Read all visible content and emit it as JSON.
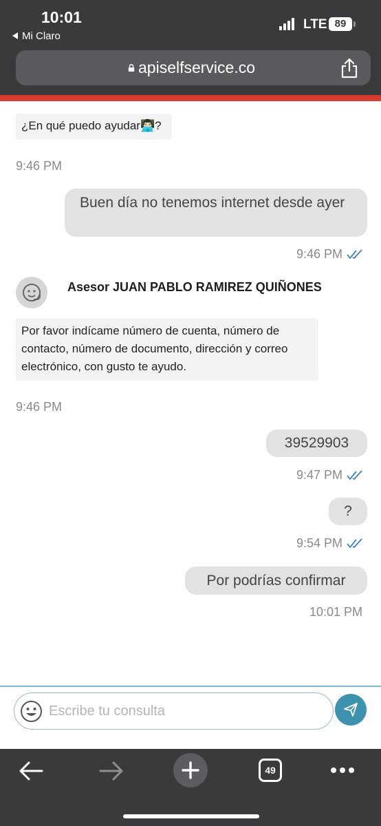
{
  "status_bar": {
    "time": "10:01",
    "back_app": "Mi Claro",
    "network": "LTE",
    "battery": "89"
  },
  "browser": {
    "url": "apiselfservice.co",
    "tab_count": "49"
  },
  "colors": {
    "accent": "#d83b2b",
    "send_button": "#3d93ad",
    "chrome": "#3a3a3c",
    "read_ticks": "#3f7fbf"
  },
  "chat": {
    "agent_name": "Asesor JUAN PABLO RAMIREZ QUIÑONES",
    "messages": [
      {
        "from": "agent",
        "text": "¿En qué puedo ayudar👨🏻‍💻?",
        "time": "9:46 PM"
      },
      {
        "from": "user",
        "text": "Buen día no tenemos internet desde ayer",
        "time": "9:46 PM"
      },
      {
        "from": "agent",
        "text": "Por favor indícame número de cuenta, número de contacto, número de documento, dirección y correo electrónico, con gusto te ayudo.",
        "time": "9:46 PM"
      },
      {
        "from": "user",
        "text": "39529903",
        "time": "9:47 PM"
      },
      {
        "from": "user",
        "text": "?",
        "time": "9:54 PM"
      },
      {
        "from": "user",
        "text": "Por podrías confirmar",
        "time": "10:01 PM"
      }
    ]
  },
  "input": {
    "placeholder": "Escribe tu consulta"
  },
  "icons": {
    "back": "arrow-left-icon",
    "forward": "arrow-right-icon",
    "new_tab": "plus-icon",
    "tabs": "tabs-icon",
    "more": "more-icon",
    "share": "share-icon",
    "emoji": "emoji-icon",
    "send": "send-icon"
  }
}
